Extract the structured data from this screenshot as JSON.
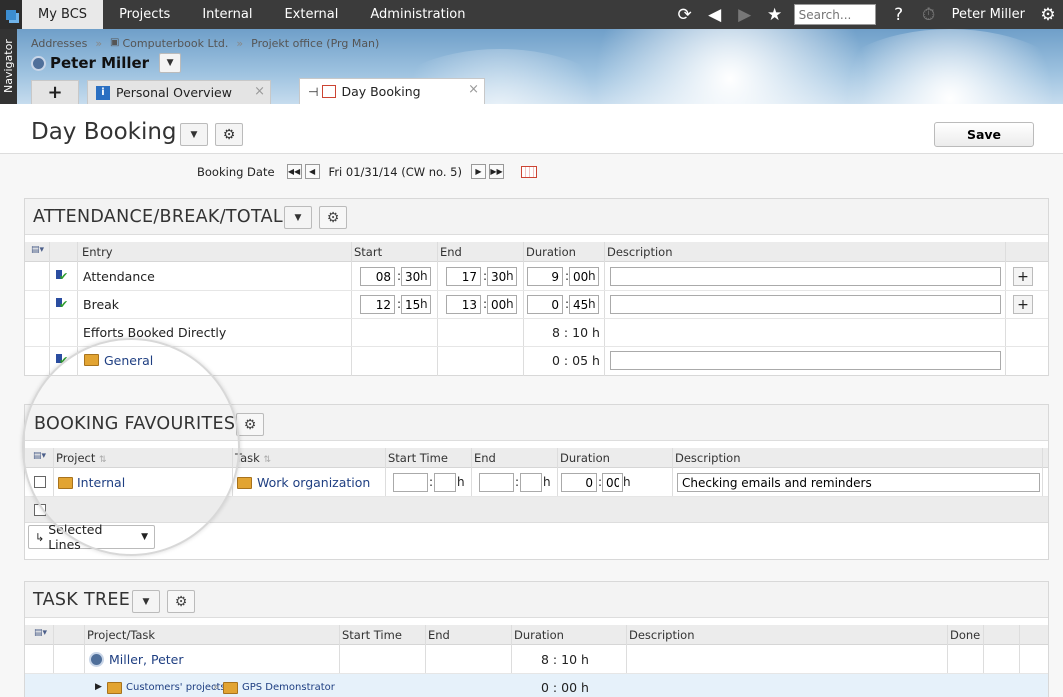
{
  "topbar": {
    "tabs": [
      "My BCS",
      "Projects",
      "Internal",
      "External",
      "Administration"
    ],
    "search_placeholder": "Search...",
    "user": "Peter Miller",
    "help": "?",
    "icons": [
      "refresh-icon",
      "back-icon",
      "forward-icon",
      "star-icon",
      "stopwatch-icon",
      "gear-icon"
    ]
  },
  "navigator": "Navigator",
  "breadcrumb": [
    "Addresses",
    "Computerbook Ltd.",
    "Projekt office (Prg Man)"
  ],
  "breadcrumb_sep": "»",
  "persona": {
    "name": "Peter Miller"
  },
  "tabs": {
    "add": "+",
    "personal": "Personal Overview",
    "day": "Day Booking"
  },
  "page": {
    "title": "Day Booking",
    "save": "Save"
  },
  "booking_date": {
    "label": "Booking Date",
    "value": "Fri 01/31/14 (CW no. 5)"
  },
  "attendance": {
    "title": "ATTENDANCE/BREAK/TOTAL",
    "columns": {
      "entry": "Entry",
      "start": "Start",
      "end": "End",
      "duration": "Duration",
      "description": "Description"
    },
    "rows": [
      {
        "entry": "Attendance",
        "start_h": "08",
        "start_m": "30",
        "end_h": "17",
        "end_m": "30",
        "dur_h": "9",
        "dur_m": "00"
      },
      {
        "entry": "Break",
        "start_h": "12",
        "start_m": "15",
        "end_h": "13",
        "end_m": "00",
        "dur_h": "0",
        "dur_m": "45"
      },
      {
        "entry": "Efforts Booked Directly",
        "duration": "8 : 10 h"
      },
      {
        "entry": "General",
        "duration": "0 : 05 h"
      }
    ],
    "unit": "h",
    "colon": ":"
  },
  "favourites": {
    "title": "BOOKING FAVOURITES",
    "columns": {
      "project": "Project",
      "task": "Task",
      "start": "Start Time",
      "end": "End",
      "duration": "Duration",
      "description": "Description"
    },
    "row": {
      "project": "Internal",
      "task": "Work organization",
      "dur_h": "0",
      "dur_m": "00",
      "description": "Checking emails and reminders"
    },
    "selected_lines": "Selected Lines"
  },
  "tasktree": {
    "title": "TASK TREE",
    "columns": {
      "task": "Project/Task",
      "start": "Start Time",
      "end": "End",
      "duration": "Duration",
      "description": "Description",
      "done": "Done"
    },
    "rows": [
      {
        "name": "Miller, Peter",
        "duration": "8 :  10 h"
      },
      {
        "path1": "Customers' projects",
        "sep": "»",
        "path2": "GPS Demonstrator",
        "duration": "0 :  00 h"
      }
    ]
  }
}
